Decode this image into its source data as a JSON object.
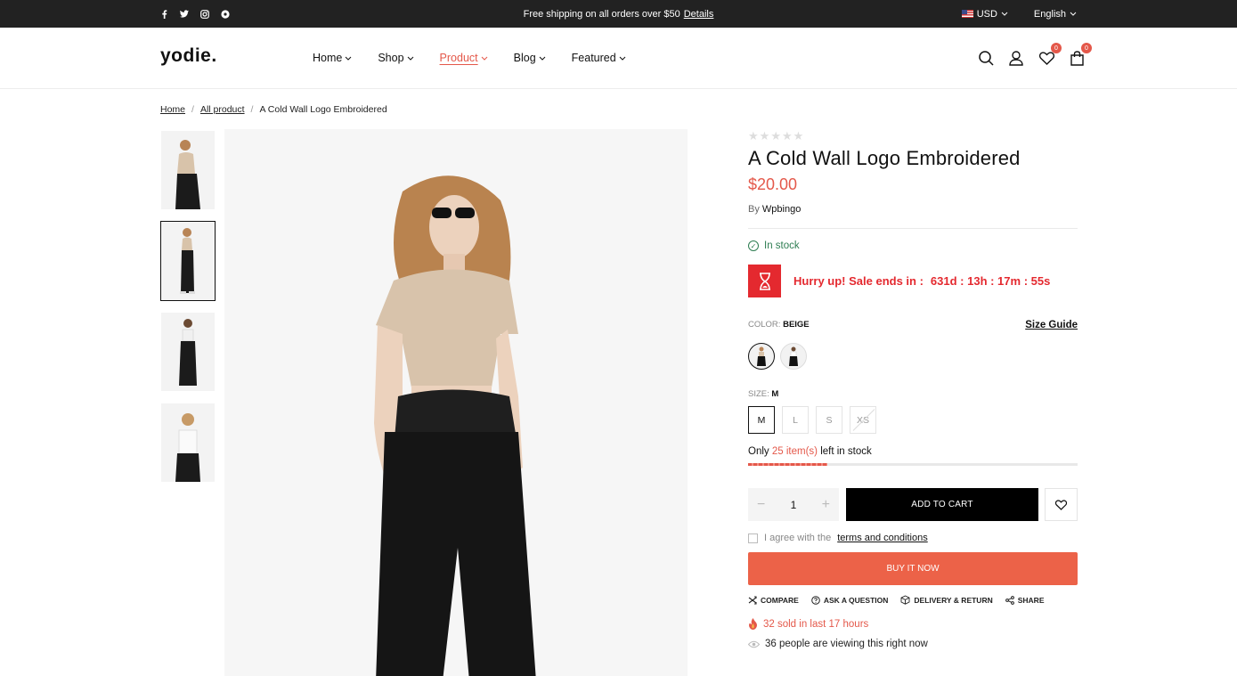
{
  "topbar": {
    "socials": [
      "facebook-icon",
      "twitter-icon",
      "instagram-icon",
      "pinterest-icon"
    ],
    "promo_text": "Free shipping on all orders over $50",
    "promo_link": "Details",
    "currency": "USD",
    "language": "English"
  },
  "header": {
    "logo": "yodie.",
    "nav": [
      "Home",
      "Shop",
      "Product",
      "Blog",
      "Featured"
    ],
    "active_nav": "Product",
    "wishlist_count": "0",
    "cart_count": "0"
  },
  "breadcrumb": {
    "items": [
      "Home",
      "All product"
    ],
    "current": "A Cold Wall Logo Embroidered"
  },
  "product": {
    "rating": 0,
    "title": "A Cold Wall Logo Embroidered",
    "price": "$20.00",
    "vendor_label": "By",
    "vendor": "Wpbingo",
    "stock_status": "In stock",
    "sale_text": "Hurry up! Sale ends in :",
    "sale_timer": "631d : 13h : 17m : 55s",
    "color_label": "COLOR:",
    "color_value": "BEIGE",
    "size_guide": "Size Guide",
    "size_label": "SIZE:",
    "size_value": "M",
    "sizes": [
      "M",
      "L",
      "S",
      "XS"
    ],
    "stock_left_prefix": "Only",
    "stock_left_count": "25 item(s)",
    "stock_left_suffix": "left in stock",
    "stock_left_fraction": 0.24,
    "quantity": "1",
    "add_to_cart": "ADD TO CART",
    "agree_text": "I agree with the",
    "terms_link": "terms and conditions",
    "buy_now": "BUY IT NOW",
    "actions": [
      "COMPARE",
      "ASK A QUESTION",
      "DELIVERY & RETURN",
      "SHARE"
    ],
    "sold_text": "32 sold in last 17 hours",
    "viewing_text": "36 people are viewing this right now"
  },
  "colors": {
    "accent": "#e4584a",
    "sale_red": "#e4292f",
    "buy_now": "#ec6248",
    "stock_green": "#2e7d52"
  }
}
